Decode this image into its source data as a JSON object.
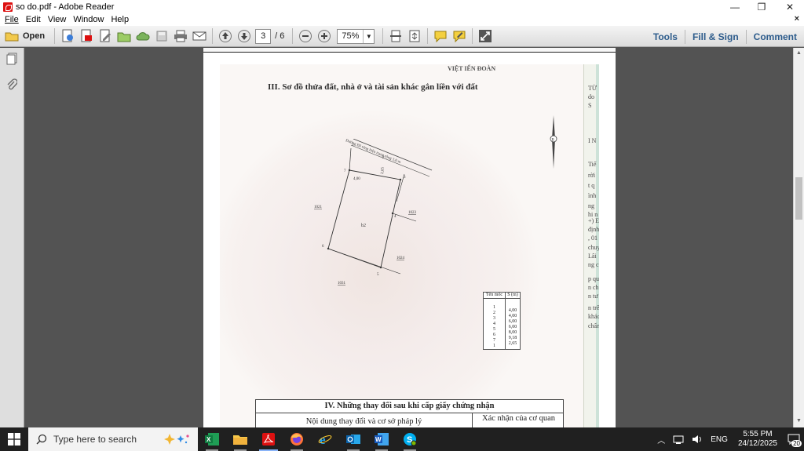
{
  "window": {
    "title": "so do.pdf - Adobe Reader",
    "minimize": "—",
    "restore": "❐",
    "close": "✕"
  },
  "menu": {
    "items": [
      "File",
      "Edit",
      "View",
      "Window",
      "Help"
    ],
    "close_doc": "×"
  },
  "toolbar": {
    "open_label": "Open",
    "current_page": "3",
    "page_count": "/ 6",
    "zoom": "75%",
    "right_links": [
      "Tools",
      "Fill & Sign",
      "Comment"
    ]
  },
  "colors": {
    "accent_link": "#2d5c8c",
    "reader_red": "#d11111",
    "taskbar": "#202020"
  },
  "document": {
    "header_fragment": "VIỆT  IẾN ĐOÀN",
    "section3_title": "III. Sơ đồ thửa đất, nhà ở và tài sản khác gắn liền với đất",
    "road_label": "Đường Bê tông hiện trạng rộng 3,0 m",
    "parcel_number": "b2",
    "neighbors": [
      "1021",
      "1023",
      "1024",
      "1031"
    ],
    "corner_points": [
      "1",
      "2",
      "3",
      "4",
      "5",
      "6",
      "7"
    ],
    "dim_top": "4,00",
    "dim_side": "2,65",
    "compass_label": "B",
    "coord_table": {
      "headers": [
        "Tên mốc",
        "S (m)"
      ],
      "points": [
        "1",
        "2",
        "3",
        "4",
        "5",
        "6",
        "7",
        "1"
      ],
      "lengths": [
        "4,00",
        "4,00",
        "6,00",
        "6,00",
        "8,00",
        "9,18",
        "2,65"
      ]
    },
    "margin_text": [
      "TỪ",
      "do",
      "S",
      "I N",
      "Tiế",
      "rời",
      "t q",
      "ình",
      "ng",
      "hi n",
      "+) E",
      "định",
      ", 01",
      "chuy",
      "Lâi",
      "ng c",
      "p qu",
      "n ch",
      "n tư",
      "n trê",
      "khác",
      "chấn"
    ],
    "section4": {
      "title": "IV. Những thay đổi sau khi cấp giấy chứng nhận",
      "col1": "Nội dung thay đổi và cơ sở pháp lý",
      "col2": "Xác nhận của cơ quan"
    }
  },
  "taskbar": {
    "search_placeholder": "Type here to search",
    "language": "ENG",
    "time": "5:55 PM",
    "date": "24/12/2025",
    "notification_count": "20",
    "apps": [
      "excel-icon",
      "file-explorer-icon",
      "adobe-reader-icon",
      "firefox-icon",
      "internet-explorer-icon",
      "outlook-icon",
      "word-icon",
      "skype-icon"
    ]
  }
}
